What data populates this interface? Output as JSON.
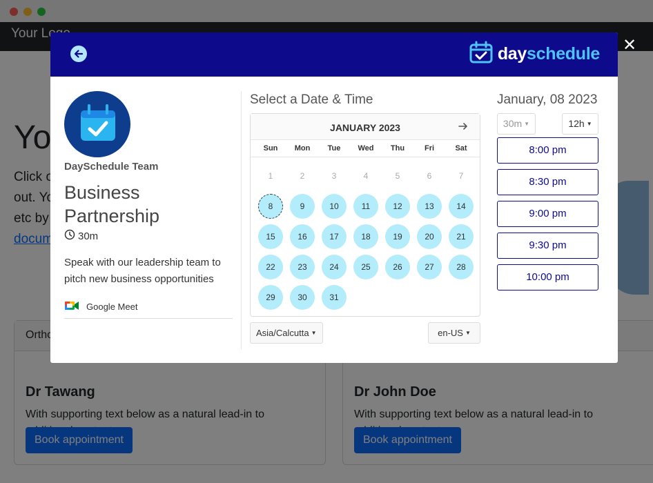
{
  "background_page": {
    "logo": "Your Logo",
    "hero_title": "Yo",
    "hero_lines": [
      "Click o",
      "out. Yo",
      "etc by",
      "docum"
    ],
    "cards": [
      {
        "header": "Ortho",
        "title": "Dr Tawang",
        "text": "With supporting text below as a natural lead-in to additional content.",
        "button": "Book appointment"
      },
      {
        "header": "",
        "title": "Dr John Doe",
        "text": "With supporting text below as a natural lead-in to additional content.",
        "button": "Book appointment"
      }
    ]
  },
  "modal": {
    "close_icon": "close-icon",
    "back_icon": "arrow-left-icon",
    "brand": {
      "part1": "day",
      "part2": "schedule",
      "icon": "calendar-check-icon"
    },
    "organizer": {
      "avatar_icon": "calendar-check-icon",
      "team": "DaySchedule Team"
    },
    "event": {
      "name": "Business Partnership",
      "duration": "30m",
      "duration_icon": "clock-icon",
      "description": "Speak with our leadership team to pitch new business opportunities",
      "location_icon": "google-meet-icon",
      "location": "Google Meet"
    },
    "calendar": {
      "title": "Select a Date & Time",
      "month": "JANUARY 2023",
      "next_icon": "arrow-right-icon",
      "weekdays": [
        "Sun",
        "Mon",
        "Tue",
        "Wed",
        "Thu",
        "Fri",
        "Sat"
      ],
      "unavailable_days": [
        "1",
        "2",
        "3",
        "4",
        "5",
        "6",
        "7"
      ],
      "available_days": [
        "8",
        "9",
        "10",
        "11",
        "12",
        "13",
        "14",
        "15",
        "16",
        "17",
        "18",
        "19",
        "20",
        "21",
        "22",
        "23",
        "24",
        "25",
        "26",
        "27",
        "28",
        "29",
        "30",
        "31"
      ],
      "selected_day": "8",
      "timezone": "Asia/Calcutta",
      "locale": "en-US"
    },
    "times": {
      "date_title": "January, 08 2023",
      "interval": "30m",
      "format": "12h",
      "slots": [
        "8:00 pm",
        "8:30 pm",
        "9:00 pm",
        "9:30 pm",
        "10:00 pm"
      ]
    },
    "colors": {
      "header": "#0d0b8c",
      "available_day": "#b3ecfb",
      "accent": "#4fc3f7"
    }
  }
}
